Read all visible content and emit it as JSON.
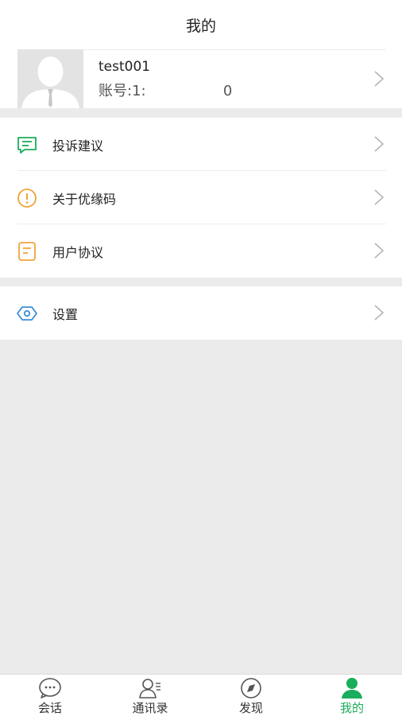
{
  "header": {
    "title": "我的"
  },
  "profile": {
    "username": "test001",
    "account": "账号:1:                 0"
  },
  "menu_section1": [
    {
      "label": "投诉建议",
      "icon": "feedback-icon",
      "color": "#1aad5b"
    },
    {
      "label": "关于优缘码",
      "icon": "info-icon",
      "color": "#f0a33a"
    },
    {
      "label": "用户协议",
      "icon": "agreement-icon",
      "color": "#f0a33a"
    }
  ],
  "menu_section2": [
    {
      "label": "设置",
      "icon": "settings-icon",
      "color": "#3a8fd8"
    }
  ],
  "tabbar": {
    "tabs": [
      {
        "label": "会话",
        "icon": "chat-icon"
      },
      {
        "label": "通讯录",
        "icon": "contacts-icon"
      },
      {
        "label": "发现",
        "icon": "compass-icon"
      },
      {
        "label": "我的",
        "icon": "user-icon",
        "active": true
      }
    ]
  },
  "colors": {
    "accent": "#1aad5b",
    "background": "#ebebeb"
  }
}
